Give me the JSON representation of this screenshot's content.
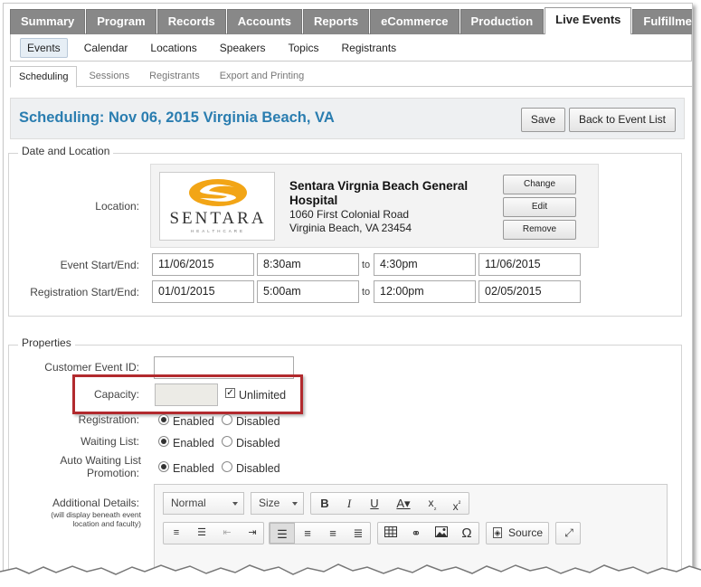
{
  "main_tabs": [
    "Summary",
    "Program",
    "Records",
    "Accounts",
    "Reports",
    "eCommerce",
    "Production",
    "Live Events",
    "Fulfillment"
  ],
  "main_tabs_active": "Live Events",
  "sub_nav": [
    "Events",
    "Calendar",
    "Locations",
    "Speakers",
    "Topics",
    "Registrants"
  ],
  "sched_tabs": [
    "Scheduling",
    "Sessions",
    "Registrants",
    "Export and Printing"
  ],
  "header": {
    "title": "Scheduling: Nov 06, 2015 Virginia Beach, VA",
    "save_label": "Save",
    "back_label": "Back to Event List"
  },
  "date_location": {
    "legend": "Date and Location",
    "location_label": "Location:",
    "logo_text": "SENTARA",
    "logo_sub": "HEALTHCARE",
    "location_name": "Sentara Virgnia Beach General Hospital",
    "address_line1": "1060 First Colonial Road",
    "address_line2": "Virginia Beach, VA 23454",
    "change_label": "Change",
    "edit_label": "Edit",
    "remove_label": "Remove",
    "event_label": "Event Start/End:",
    "event_start_date": "11/06/2015",
    "event_start_time": "8:30am",
    "to": "to",
    "event_end_time": "4:30pm",
    "event_end_date": "11/06/2015",
    "reg_label": "Registration Start/End:",
    "reg_start_date": "01/01/2015",
    "reg_start_time": "5:00am",
    "reg_end_time": "12:00pm",
    "reg_end_date": "02/05/2015"
  },
  "properties": {
    "legend": "Properties",
    "customer_event_id_label": "Customer Event ID:",
    "customer_event_id_value": "",
    "capacity_label": "Capacity:",
    "capacity_value": "",
    "unlimited_label": "Unlimited",
    "unlimited_checked": true,
    "registration_label": "Registration:",
    "waiting_list_label": "Waiting List:",
    "auto_waiting_label_1": "Auto Waiting List",
    "auto_waiting_label_2": "Promotion:",
    "enabled": "Enabled",
    "disabled": "Disabled",
    "additional_label": "Additional Details:",
    "additional_note_1": "(will display beneath event",
    "additional_note_2": "location and faculty)"
  },
  "editor": {
    "format_value": "Normal",
    "size_value": "Size",
    "source_label": "Source"
  },
  "colors": {
    "title": "#2a7db0",
    "highlight": "#b22a2e",
    "tab_bg": "#888888",
    "logo_orange": "#f2a516"
  }
}
